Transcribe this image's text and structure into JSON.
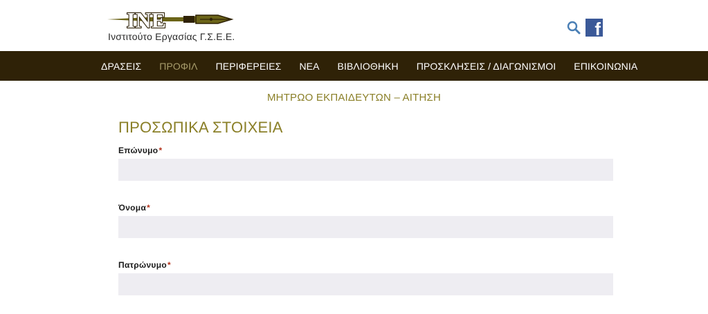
{
  "header": {
    "logo_text": "INE",
    "logo_subtitle": "Ινστιτούτο Εργασίας Γ.Σ.Ε.Ε.",
    "search_icon": "search-icon",
    "facebook_icon": "facebook-icon",
    "facebook_glyph": "f"
  },
  "nav": {
    "items": [
      {
        "label": "ΔΡΑΣΕΙΣ",
        "active": false
      },
      {
        "label": "ΠΡΟΦΙΛ",
        "active": true
      },
      {
        "label": "ΠΕΡΙΦΕΡΕΙΕΣ",
        "active": false
      },
      {
        "label": "ΝΕΑ",
        "active": false
      },
      {
        "label": "ΒΙΒΛΙΟΘΗΚΗ",
        "active": false
      },
      {
        "label": "ΠΡΟΣΚΛΗΣΕΙΣ / ΔΙΑΓΩΝΙΣΜΟΙ",
        "active": false
      },
      {
        "label": "ΕΠΙΚΟΙΝΩΝΙΑ",
        "active": false
      }
    ]
  },
  "main": {
    "page_heading": "ΜΗΤΡΩΟ ΕΚΠΑΙΔΕΥΤΩΝ – ΑΙΤΗΣΗ",
    "section_title": "ΠΡΟΣΩΠΙΚΑ ΣΤΟΙΧΕΙΑ",
    "fields": [
      {
        "label": "Επώνυμο",
        "required_mark": "*",
        "value": ""
      },
      {
        "label": "Όνομα",
        "required_mark": "*",
        "value": ""
      },
      {
        "label": "Πατρώνυμο",
        "required_mark": "*",
        "value": ""
      }
    ]
  },
  "colors": {
    "nav_bg": "#2f2207",
    "nav_active": "#a79c6b",
    "accent_olive": "#8a7f27",
    "required": "#b5341d",
    "input_bg": "#eeedf2",
    "facebook_blue": "#3b5998",
    "search_blue": "#4a7fb5"
  }
}
